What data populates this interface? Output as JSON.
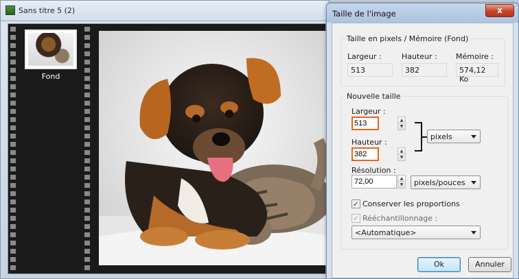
{
  "document_window": {
    "title": "Sans titre 5 (2)",
    "layer_label": "Fond"
  },
  "dialog": {
    "title": "Taille de l'image",
    "close_symbol": "x",
    "current_group": {
      "legend": "Taille en pixels / Mémoire (Fond)",
      "width_label": "Largeur :",
      "height_label": "Hauteur :",
      "memory_label": "Mémoire :",
      "width_value": "513",
      "height_value": "382",
      "memory_value": "574,12 Ko"
    },
    "new_group": {
      "legend": "Nouvelle taille",
      "width_label": "Largeur :",
      "width_value": "513",
      "height_label": "Hauteur :",
      "height_value": "382",
      "unit_select": "pixels",
      "resolution_label": "Résolution :",
      "resolution_value": "72,00",
      "resolution_unit_select": "pixels/pouces",
      "keep_proportions_label": "Conserver les proportions",
      "keep_proportions_checked": true,
      "resample_label": "Rééchantillonnage :",
      "resample_checked": true,
      "resample_method": "<Automatique>"
    },
    "ok_label": "Ok",
    "cancel_label": "Annuler"
  },
  "colors": {
    "highlight": "#e8661b",
    "dialog_frame": "#d7e1ee",
    "close_button": "#c7432a"
  },
  "icons": {
    "spin_up": "▲",
    "spin_down": "▼"
  }
}
